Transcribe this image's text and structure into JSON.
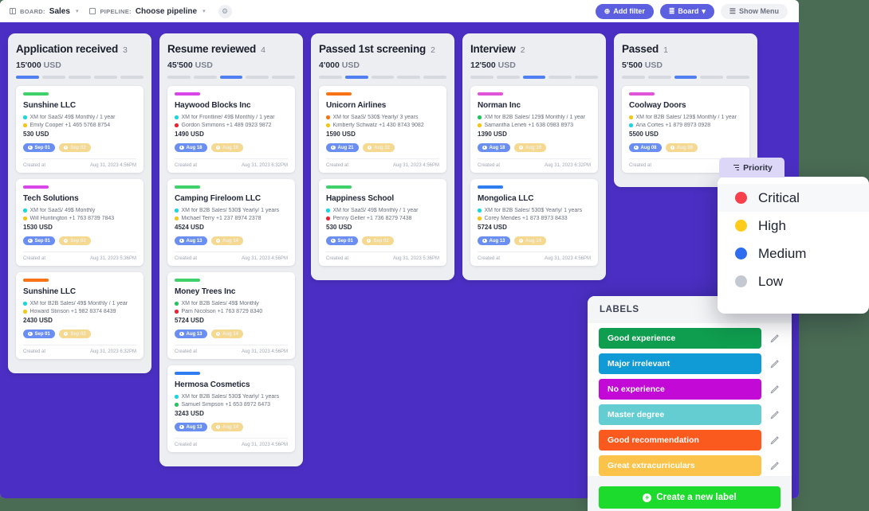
{
  "topbar": {
    "board_label": "BOARD:",
    "board_value": "Sales",
    "pipeline_label": "PIPELINE:",
    "pipeline_value": "Choose pipeline",
    "gear_icon": "gear-icon",
    "add_filter": "Add filter",
    "add_filter_icon": "plus-circle-icon",
    "board_button": "Board",
    "board_button_icon": "filter-icon",
    "show_menu": "Show Menu",
    "show_menu_icon": "hamburger-icon",
    "colors": {
      "primary": "#5b5fe0",
      "board_bg": "#4b2fc4"
    }
  },
  "columns": [
    {
      "title": "Application received",
      "count": "3",
      "amount_value": "15'000",
      "amount_currency": "USD",
      "active_step": 0,
      "steps": 5,
      "cards": [
        {
          "bar_color": "#3fd16a",
          "title": "Sunshine LLC",
          "line1": "XM for SaaS/ 49$ Monthly / 1 year",
          "line1_dot": "#17d7e0",
          "line2": "Emily Cooper +1 465 5768 8754",
          "line2_dot": "#f5c518",
          "amount": "530 USD",
          "chip1": "Sep 01",
          "chip2": "Sep 02",
          "created_label": "Created at",
          "created_at": "Aug 31, 2023 4:56PM"
        },
        {
          "bar_color": "#d946e8",
          "title": "Tech Solutions",
          "line1": "XM for SaaS/ 49$ Monthly",
          "line1_dot": "#17d7e0",
          "line2": "Will Huntington +1 763 8739 7843",
          "line2_dot": "#f5c518",
          "amount": "1530 USD",
          "chip1": "Sep 01",
          "chip2": "Sep 02",
          "created_label": "Created at",
          "created_at": "Aug 31, 2023 5:36PM"
        },
        {
          "bar_color": "#f97316",
          "title": "Sunshine LLC",
          "line1": "XM for B2B Sales/ 49$ Monthly / 1 year",
          "line1_dot": "#17d7e0",
          "line2": "Howard Stinson +1 982 8374 8439",
          "line2_dot": "#f5c518",
          "amount": "2430 USD",
          "chip1": "Sep 01",
          "chip2": "Sep 02",
          "created_label": "Created at",
          "created_at": "Aug 31, 2023 6:32PM"
        }
      ]
    },
    {
      "title": "Resume reviewed",
      "count": "4",
      "amount_value": "45'500",
      "amount_currency": "USD",
      "active_step": 2,
      "steps": 5,
      "cards": [
        {
          "bar_color": "#d946e8",
          "title": "Haywood Blocks Inc",
          "line1": "XM for Frontline/ 49$ Monthly / 1 year",
          "line1_dot": "#17d7e0",
          "line2": "Gordon Simmons +1 489 0923 9872",
          "line2_dot": "#ef2233",
          "amount": "1490 USD",
          "chip1": "Aug 18",
          "chip2": "Aug 19",
          "created_label": "Created at",
          "created_at": "Aug 31, 2023 6:32PM"
        },
        {
          "bar_color": "#3fd16a",
          "title": "Camping Fireloom LLC",
          "line1": "XM for B2B Sales/ 530$ Yearly/ 1 years",
          "line1_dot": "#17d7e0",
          "line2": "Michael Terry +1 237 8974 2378",
          "line2_dot": "#f5c518",
          "amount": "4524 USD",
          "chip1": "Aug 13",
          "chip2": "Aug 14",
          "created_label": "Created at",
          "created_at": "Aug 31, 2023 4:56PM"
        },
        {
          "bar_color": "#3fd16a",
          "title": "Money Trees Inc",
          "line1": "XM for B2B Sales/ 49$ Monthly",
          "line1_dot": "#22c55e",
          "line2": "Pam Nicolson +1 763 8729 8340",
          "line2_dot": "#ef2233",
          "amount": "5724 USD",
          "chip1": "Aug 13",
          "chip2": "Aug 14",
          "created_label": "Created at",
          "created_at": "Aug 31, 2023 4:56PM"
        },
        {
          "bar_color": "#2f7df0",
          "title": "Hermosa Cosmetics",
          "line1": "XM for B2B Sales/ 530$ Yearly/ 1 years",
          "line1_dot": "#17d7e0",
          "line2": "Samuel Simpson +1 653 8972 6473",
          "line2_dot": "#22c55e",
          "amount": "3243 USD",
          "chip1": "Aug 13",
          "chip2": "Aug 14",
          "created_label": "Created at",
          "created_at": "Aug 31, 2023 4:56PM"
        }
      ]
    },
    {
      "title": "Passed 1st screening",
      "count": "2",
      "amount_value": "4'000",
      "amount_currency": "USD",
      "active_step": 1,
      "steps": 5,
      "cards": [
        {
          "bar_color": "#f97316",
          "title": "Unicorn Airlines",
          "line1": "XM for SaaS/ 530$ Yearly/ 3 years",
          "line1_dot": "#f97316",
          "line2": "Kimberly Schwatz +1 430 8743 9082",
          "line2_dot": "#f5c518",
          "amount": "1590 USD",
          "chip1": "Aug 21",
          "chip2": "Aug 22",
          "created_label": "Created at",
          "created_at": "Aug 31, 2023 4:56PM"
        },
        {
          "bar_color": "#3fd16a",
          "title": "Happiness School",
          "line1": "XM for SaaS/ 49$ Monthly / 1 year",
          "line1_dot": "#17d7e0",
          "line2": "Penny Geller +1 736 8279 7438",
          "line2_dot": "#ef2233",
          "amount": "530 USD",
          "chip1": "Sep 01",
          "chip2": "Sep 02",
          "created_label": "Created at",
          "created_at": "Aug 31, 2023 5:36PM"
        }
      ]
    },
    {
      "title": "Interview",
      "count": "2",
      "amount_value": "12'500",
      "amount_currency": "USD",
      "active_step": 2,
      "steps": 5,
      "cards": [
        {
          "bar_color": "#e055d8",
          "title": "Norman Inc",
          "line1": "XM for B2B Sales/ 129$ Monthly / 1 year",
          "line1_dot": "#22c55e",
          "line2": "Samantha Leneti +1 638 0983 8973",
          "line2_dot": "#f5c518",
          "amount": "1390 USD",
          "chip1": "Aug 18",
          "chip2": "Aug 19",
          "created_label": "Created at",
          "created_at": "Aug 31, 2023 6:32PM"
        },
        {
          "bar_color": "#2f7df0",
          "title": "Mongolica LLC",
          "line1": "XM for B2B Sales/ 530$ Yearly/ 1 years",
          "line1_dot": "#17d7e0",
          "line2": "Corey Mendes +1 873 8973 8433",
          "line2_dot": "#f5c518",
          "amount": "5724 USD",
          "chip1": "Aug 13",
          "chip2": "Aug 14",
          "created_label": "Created at",
          "created_at": "Aug 31, 2023 4:56PM"
        }
      ]
    },
    {
      "title": "Passed",
      "count": "1",
      "amount_value": "5'500",
      "amount_currency": "USD",
      "active_step": 2,
      "steps": 5,
      "cards": [
        {
          "bar_color": "#e055d8",
          "title": "Coolway Doors",
          "line1": "XM for B2B Sales/ 129$ Monthly / 1 year",
          "line1_dot": "#f5c518",
          "line2": "Ana Cortes +1 879 8973 0928",
          "line2_dot": "#17d7e0",
          "amount": "5500 USD",
          "chip1": "Aug 08",
          "chip2": "Aug 09",
          "created_label": "Created at",
          "created_at": ""
        }
      ]
    }
  ],
  "priority": {
    "button_label": "Priority",
    "button_icon": "sort-icon",
    "items": [
      {
        "label": "Critical",
        "color": "#f8414a"
      },
      {
        "label": "High",
        "color": "#ffcc1a"
      },
      {
        "label": "Medium",
        "color": "#2f6df0"
      },
      {
        "label": "Low",
        "color": "#c4c8d0"
      }
    ]
  },
  "labels": {
    "heading": "LABELS",
    "edit_icon": "pencil-icon",
    "items": [
      {
        "text": "Good experience",
        "color": "#0f9d4f"
      },
      {
        "text": "Major irrelevant",
        "color": "#109ad6"
      },
      {
        "text": "No experience",
        "color": "#c209d6"
      },
      {
        "text": "Master degree",
        "color": "#63cdd1"
      },
      {
        "text": "Good recommendation",
        "color": "#fb5a1e"
      },
      {
        "text": "Great extracurriculars",
        "color": "#fbc34a"
      }
    ],
    "create_label": "Create a new label",
    "create_icon": "plus-circle-icon",
    "create_color": "#1ddb2c"
  }
}
